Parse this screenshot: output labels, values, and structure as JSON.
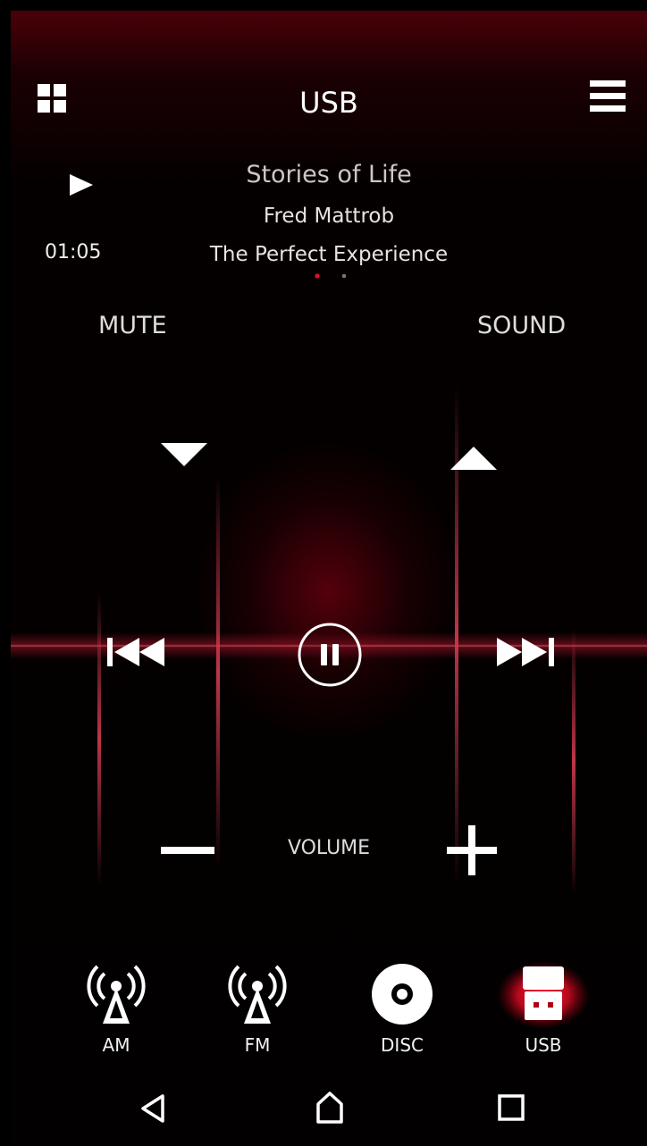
{
  "header": {
    "title": "USB",
    "left_icon": "grid-icon",
    "right_icon": "hamburger-menu-icon"
  },
  "now_playing": {
    "state_icon": "play-icon",
    "elapsed": "01:05",
    "track": "Stories of Life",
    "artist": "Fred Mattrob",
    "album": "The Perfect Experience",
    "pages": 2,
    "active_page": 1
  },
  "controls": {
    "mute_label": "MUTE",
    "sound_label": "SOUND",
    "volume_label": "VOLUME",
    "icons": [
      "triangle-down-icon",
      "triangle-up-icon",
      "previous-track-icon",
      "pause-icon",
      "next-track-icon",
      "minus-icon",
      "plus-icon"
    ]
  },
  "sources": [
    {
      "label": "AM",
      "icon": "antenna-icon",
      "active": false
    },
    {
      "label": "FM",
      "icon": "antenna-icon",
      "active": false
    },
    {
      "label": "DISC",
      "icon": "disc-icon",
      "active": false
    },
    {
      "label": "USB",
      "icon": "usb-drive-icon",
      "active": true
    }
  ],
  "navbar": {
    "icons": [
      "back-icon",
      "home-icon",
      "recents-icon"
    ]
  },
  "colors": {
    "accent": "#e0102a",
    "background": "#050000",
    "wave": "#c8384e"
  }
}
